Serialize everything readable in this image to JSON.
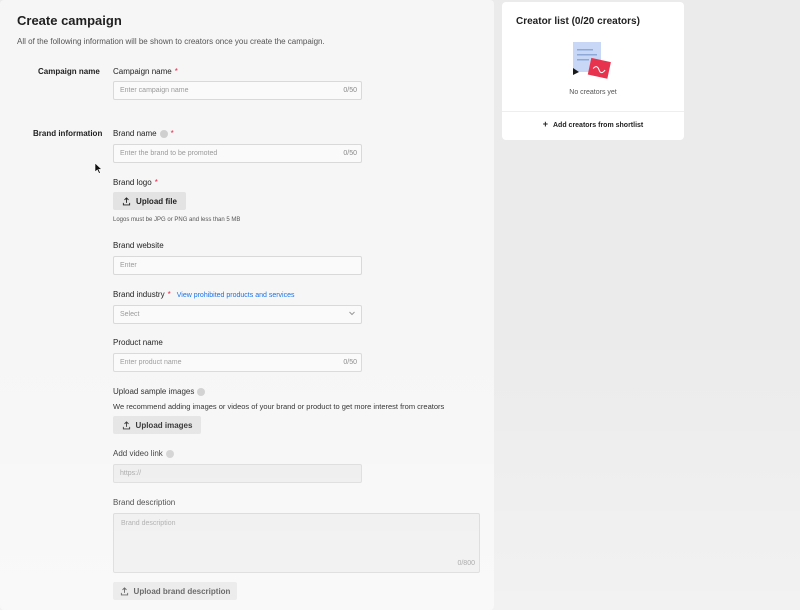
{
  "main": {
    "title": "Create campaign",
    "subtitle": "All of the following information will be shown to creators once you create the campaign.",
    "sections": {
      "campaign": "Campaign name",
      "brand": "Brand information"
    },
    "fields": {
      "campaign_name": {
        "label": "Campaign name",
        "placeholder": "Enter campaign name",
        "counter": "0/50",
        "required": "*"
      },
      "brand_name": {
        "label": "Brand name",
        "placeholder": "Enter the brand to be promoted",
        "counter": "0/50",
        "required": "*"
      },
      "brand_logo": {
        "label": "Brand logo",
        "required": "*",
        "button": "Upload file",
        "hint": "Logos must be JPG or PNG and less than 5 MB"
      },
      "brand_website": {
        "label": "Brand website",
        "placeholder": "Enter"
      },
      "brand_industry": {
        "label": "Brand industry",
        "required": "*",
        "link": "View prohibited products and services",
        "placeholder": "Select"
      },
      "product_name": {
        "label": "Product name",
        "placeholder": "Enter product name",
        "counter": "0/50"
      },
      "sample_images": {
        "label": "Upload sample images",
        "hint": "We recommend adding images or videos of your brand or product to get more interest from creators",
        "button": "Upload images"
      },
      "video_link": {
        "label": "Add video link",
        "placeholder": "https://"
      },
      "brand_description": {
        "label": "Brand description",
        "placeholder": "Brand description",
        "counter": "0/800",
        "button": "Upload brand description"
      }
    }
  },
  "side": {
    "title": "Creator list (0/20 creators)",
    "empty_text": "No creators yet",
    "add_link": "Add creators from shortlist",
    "add_icon": "+"
  },
  "icons": {
    "upload": "upload-icon",
    "info": "info-icon",
    "chevron": "chevron-down-icon",
    "cursor": "mouse-cursor-icon"
  },
  "colors": {
    "required": "#e5294b",
    "link": "#1a73e8",
    "illustration_red": "#e8334e",
    "illustration_blue": "#c7d7f5"
  }
}
